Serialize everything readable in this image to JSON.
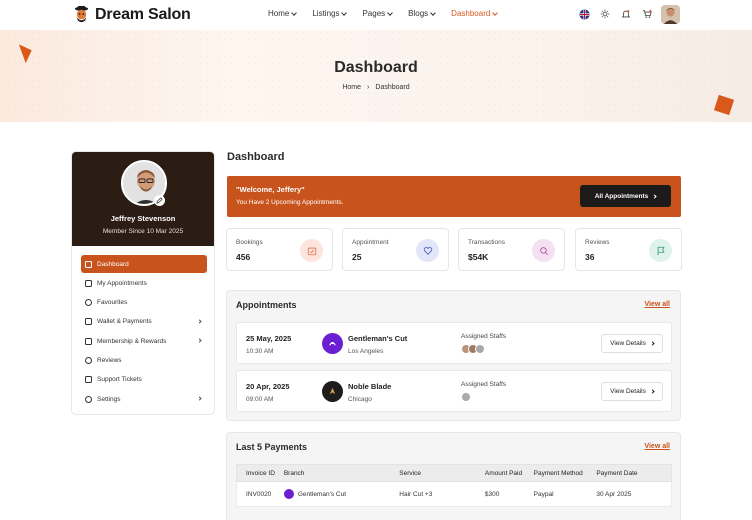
{
  "brand": {
    "name": "Dream Salon"
  },
  "nav": {
    "items": [
      {
        "label": "Home",
        "active": false
      },
      {
        "label": "Listings",
        "active": false
      },
      {
        "label": "Pages",
        "active": false
      },
      {
        "label": "Blogs",
        "active": false
      },
      {
        "label": "Dashboard",
        "active": true
      }
    ]
  },
  "hero": {
    "title": "Dashboard",
    "breadcrumb": [
      "Home",
      "Dashboard"
    ]
  },
  "profile": {
    "name": "Jeffrey Stevenson",
    "member_since": "Member Since 10 Mar 2025"
  },
  "sidebar": {
    "items": [
      {
        "label": "Dashboard",
        "active": true,
        "has_arrow": false,
        "icon": "dashboard-icon"
      },
      {
        "label": "My Appointments",
        "active": false,
        "has_arrow": false,
        "icon": "calendar-icon"
      },
      {
        "label": "Favourites",
        "active": false,
        "has_arrow": false,
        "icon": "heart-icon"
      },
      {
        "label": "Wallet & Payments",
        "active": false,
        "has_arrow": true,
        "icon": "wallet-icon"
      },
      {
        "label": "Membership & Rewards",
        "active": false,
        "has_arrow": true,
        "icon": "membership-icon"
      },
      {
        "label": "Reviews",
        "active": false,
        "has_arrow": false,
        "icon": "star-icon"
      },
      {
        "label": "Support Tickets",
        "active": false,
        "has_arrow": false,
        "icon": "ticket-icon"
      },
      {
        "label": "Settings",
        "active": false,
        "has_arrow": true,
        "icon": "settings-icon"
      }
    ]
  },
  "main": {
    "title": "Dashboard",
    "welcome": {
      "title": "\"Welcome, Jeffery\"",
      "subtitle": "You Have 2 Upcoming Appointments.",
      "button": "All Appointments"
    },
    "stats": [
      {
        "label": "Bookings",
        "value": "456",
        "icon": "calendar-check-icon",
        "color": "#fde4dc",
        "icon_color": "#e0704a"
      },
      {
        "label": "Appointment",
        "value": "25",
        "icon": "heart-icon",
        "color": "#e2e6f8",
        "icon_color": "#4a5fc1"
      },
      {
        "label": "Transactions",
        "value": "$54K",
        "icon": "search-icon",
        "color": "#f3e0f1",
        "icon_color": "#b13fa6"
      },
      {
        "label": "Reviews",
        "value": "36",
        "icon": "flag-icon",
        "color": "#dff2ec",
        "icon_color": "#2f9a78"
      }
    ],
    "appointments": {
      "title": "Appointments",
      "view_all": "View all",
      "staff_label": "Assigned Staffs",
      "button": "View Details",
      "items": [
        {
          "date": "25 May, 2025",
          "time": "10:30 AM",
          "name": "Gentleman's Cut",
          "city": "Los Angeles",
          "logo_color": "#6a1fd1",
          "staff_count": 3
        },
        {
          "date": "20 Apr, 2025",
          "time": "09:00 AM",
          "name": "Noble Blade",
          "city": "Chicago",
          "logo_color": "#1f1d1b",
          "staff_count": 1
        }
      ]
    },
    "payments": {
      "title": "Last 5 Payments",
      "view_all": "View all",
      "columns": [
        "Invoice ID",
        "Branch",
        "Service",
        "Amount Paid",
        "Payment Method",
        "Payment Date"
      ],
      "rows": [
        {
          "invoice": "INV0020",
          "branch": "Gentleman's Cut",
          "service": "Hair Cut +3",
          "amount": "$300",
          "method": "Paypal",
          "date": "30 Apr 2025",
          "color": "#6a1fd1"
        }
      ]
    }
  }
}
